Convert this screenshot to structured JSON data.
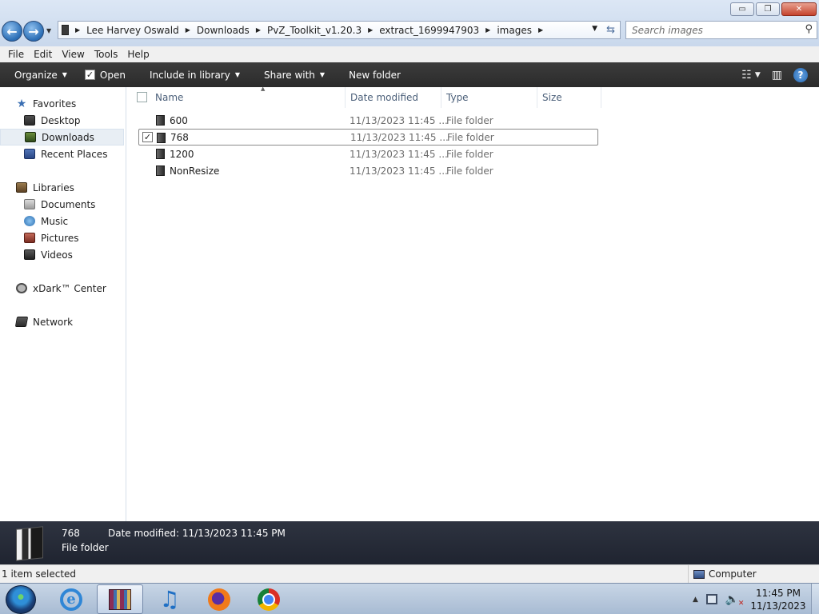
{
  "window": {
    "controls": {
      "minimize": "▭",
      "maximize": "❐",
      "close": "✕"
    }
  },
  "address": {
    "crumbs": [
      "Lee Harvey Oswald",
      "Downloads",
      "PvZ_Toolkit_v1.20.3",
      "extract_1699947903",
      "images"
    ]
  },
  "search": {
    "placeholder": "Search images"
  },
  "menu": [
    "File",
    "Edit",
    "View",
    "Tools",
    "Help"
  ],
  "toolbar": {
    "organize": "Organize",
    "open": "Open",
    "include_in_library": "Include in library",
    "share_with": "Share with",
    "new_folder": "New folder"
  },
  "nav": {
    "favorites": {
      "label": "Favorites",
      "items": [
        "Desktop",
        "Downloads",
        "Recent Places"
      ],
      "selected": "Downloads"
    },
    "libraries": {
      "label": "Libraries",
      "items": [
        "Documents",
        "Music",
        "Pictures",
        "Videos"
      ]
    },
    "xdark": "xDark™ Center",
    "network": "Network"
  },
  "columns": {
    "name": "Name",
    "date": "Date modified",
    "type": "Type",
    "size": "Size"
  },
  "files": [
    {
      "name": "600",
      "date": "11/13/2023 11:45 ...",
      "type": "File folder",
      "selected": false
    },
    {
      "name": "768",
      "date": "11/13/2023 11:45 ...",
      "type": "File folder",
      "selected": true
    },
    {
      "name": "1200",
      "date": "11/13/2023 11:45 ...",
      "type": "File folder",
      "selected": false
    },
    {
      "name": "NonResize",
      "date": "11/13/2023 11:45 ...",
      "type": "File folder",
      "selected": false
    }
  ],
  "details": {
    "name": "768",
    "modified": "Date modified: 11/13/2023 11:45 PM",
    "type": "File folder"
  },
  "status": {
    "selection": "1 item selected",
    "location": "Computer"
  },
  "taskbar": {
    "apps": [
      "internet-explorer-icon",
      "winrar-icon",
      "itunes-icon",
      "firefox-icon",
      "chrome-icon"
    ],
    "time": "11:45 PM",
    "date": "11/13/2023"
  }
}
